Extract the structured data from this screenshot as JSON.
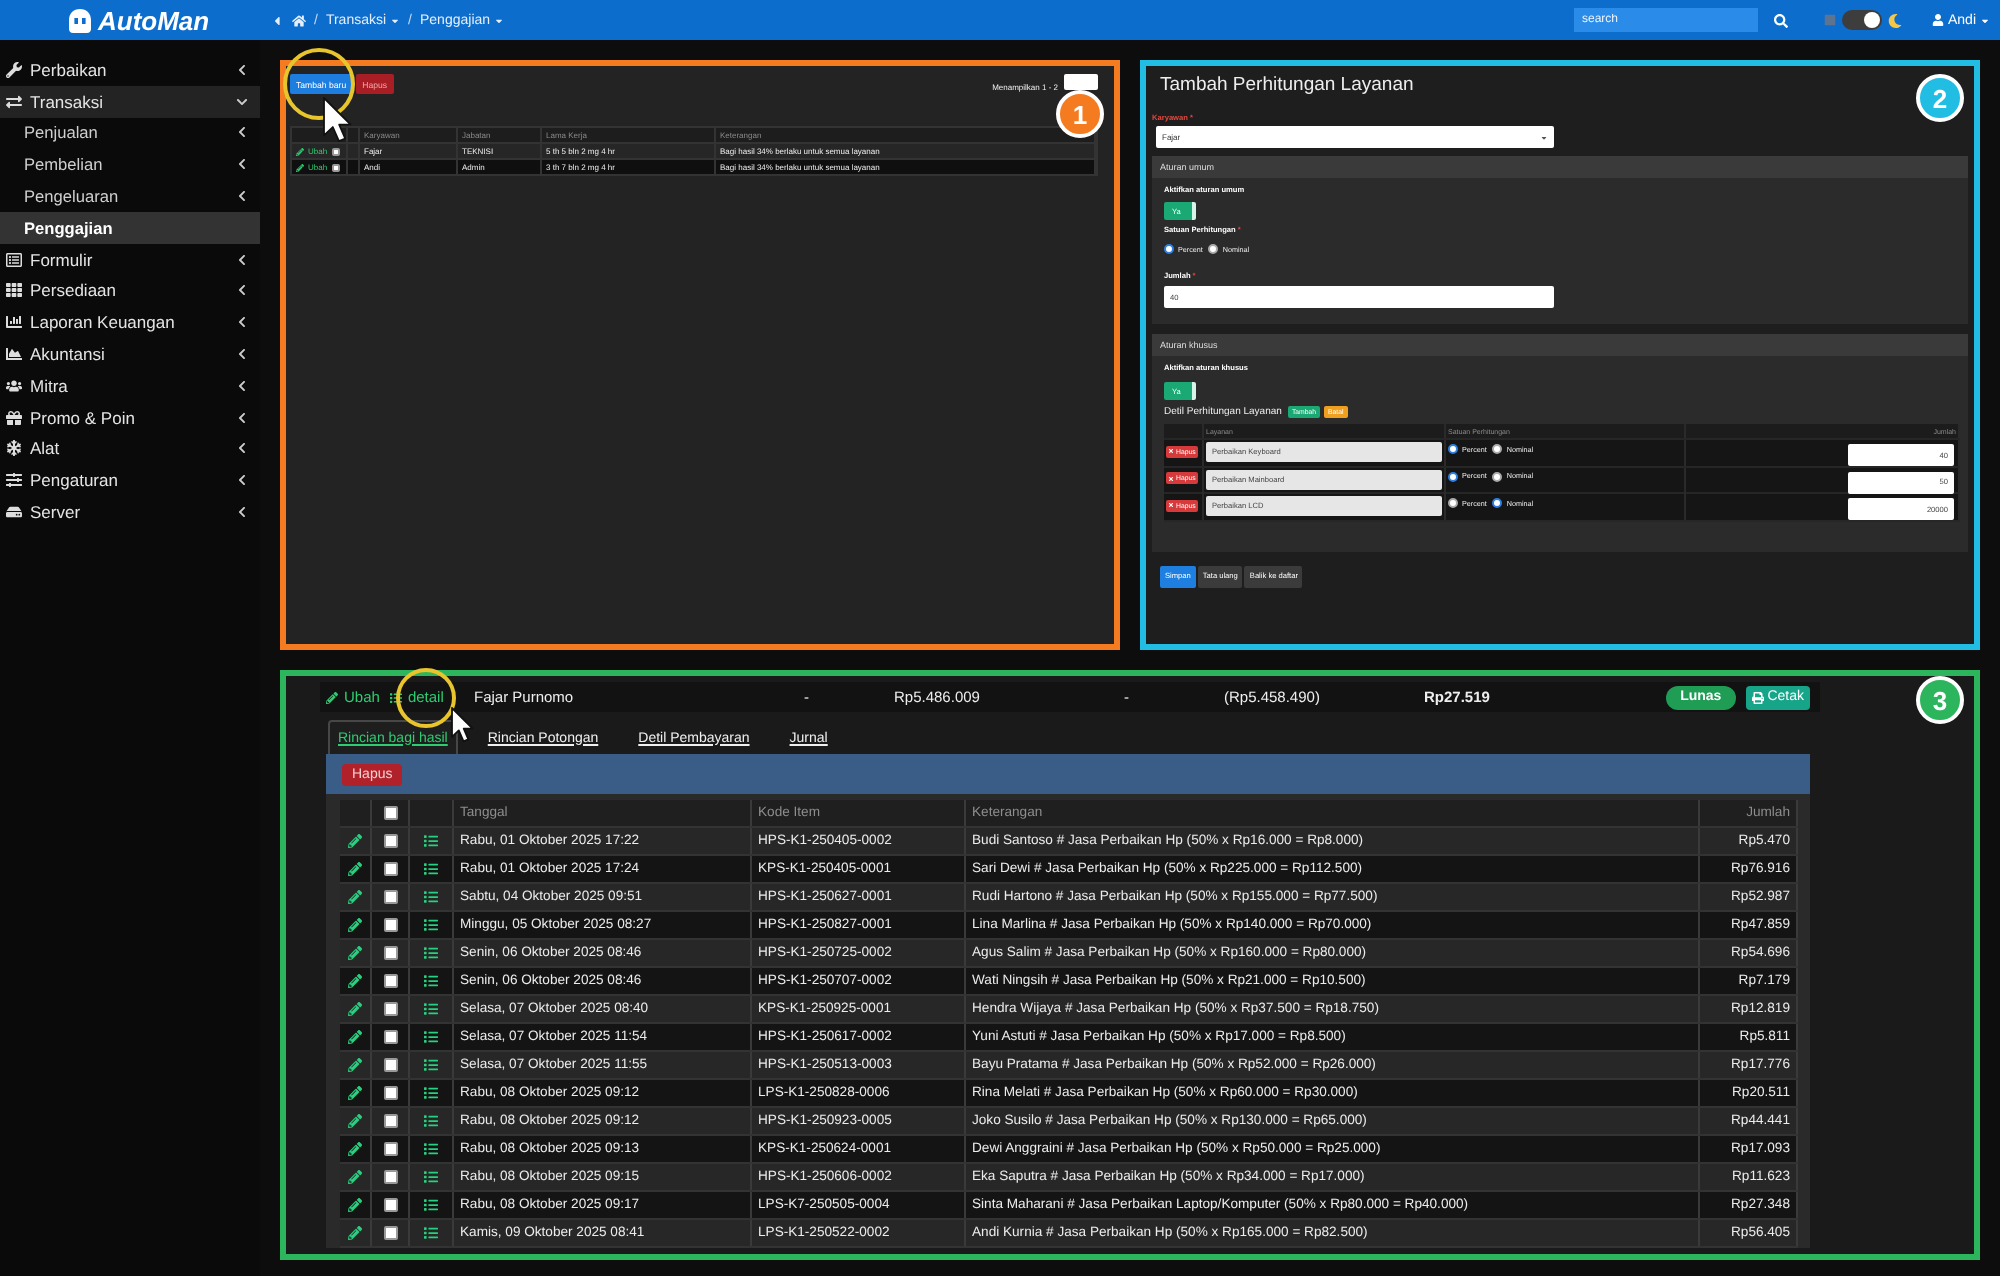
{
  "top_bar": {
    "logo": "AutoMan",
    "breadcrumb": [
      {
        "kind": "home"
      },
      {
        "kind": "link",
        "separator": "/",
        "label": "Transaksi",
        "dropdown": true
      },
      {
        "kind": "link",
        "separator": "/",
        "label": "Penggajian",
        "dropdown": true
      }
    ],
    "search": {
      "placeholder": "search"
    },
    "theme_toggle": {
      "on": true
    },
    "user": {
      "name": "Andi",
      "dropdown": true
    }
  },
  "sidebar": {
    "items": [
      {
        "label": "Perbaikan",
        "expanded": false
      },
      {
        "label": "Transaksi",
        "expanded": true,
        "children": [
          {
            "label": "Penjualan",
            "submenu": true,
            "selected": false
          },
          {
            "label": "Pembelian",
            "submenu": true,
            "selected": false
          },
          {
            "label": "Pengeluaran",
            "submenu": true,
            "selected": false
          },
          {
            "label": "Penggajian",
            "submenu": false,
            "selected": true
          }
        ]
      },
      {
        "label": "Formulir",
        "expanded": false
      },
      {
        "label": "Persediaan",
        "expanded": false
      },
      {
        "label": "Laporan Keuangan",
        "expanded": false
      },
      {
        "label": "Akuntansi",
        "expanded": false
      },
      {
        "label": "Mitra",
        "expanded": false
      },
      {
        "label": "Promo & Poin",
        "expanded": false
      },
      {
        "label": "Alat",
        "expanded": false
      },
      {
        "label": "Pengaturan",
        "expanded": false
      },
      {
        "label": "Server",
        "expanded": false
      }
    ]
  },
  "panels": [
    {
      "kind": "employee_list",
      "badge": "1",
      "color": "#f47b20",
      "buttons": [
        {
          "kind": "primary",
          "label": "Tambah baru"
        },
        {
          "kind": "danger",
          "label": "Hapus"
        }
      ],
      "showing": "Menampilkan 1 - 2",
      "columns": [
        "Karyawan",
        "Jabatan",
        "Lama Kerja",
        "Keterangan"
      ],
      "rows": [
        {
          "edit": "Ubah",
          "checked": false,
          "cells": [
            "Fajar",
            "TEKNISI",
            "5 th 5 bln 2 mg 4 hr",
            "Bagi hasil 34% berlaku untuk semua layanan"
          ]
        },
        {
          "edit": "Ubah",
          "checked": false,
          "cells": [
            "Andi",
            "Admin",
            "3 th 7 bln 2 mg 4 hr",
            "Bagi hasil 34% berlaku untuk semua layanan"
          ]
        }
      ]
    },
    {
      "kind": "service_form",
      "badge": "2",
      "color": "#22bde3",
      "title": "Tambah Perhitungan Layanan",
      "employee": {
        "label": "Karyawan",
        "required_mark": "*",
        "value": "Fajar"
      },
      "general_rule": {
        "heading": "Aturan umum",
        "enable_label": "Aktifkan aturan umum",
        "toggle": {
          "label": "Ya",
          "on": true
        },
        "unit": {
          "label": "Satuan Perhitungan",
          "required_mark": "*",
          "options": [
            {
              "label": "Percent",
              "selected": true
            },
            {
              "label": "Nominal",
              "selected": false
            }
          ]
        },
        "amount": {
          "label": "Jumlah",
          "required_mark": "*",
          "value": "40"
        }
      },
      "special_rule": {
        "heading": "Aturan khusus",
        "enable_label": "Aktifkan aturan khusus",
        "toggle": {
          "label": "Ya",
          "on": true
        },
        "detail_label": "Detil Perhitungan Layanan",
        "add_button": "Tambah",
        "cancel_button": "Batal",
        "columns": [
          "Layanan",
          "Satuan Perhitungan",
          "Jumlah"
        ],
        "rows": [
          {
            "delete_button": "Hapus",
            "service": "Perbaikan Keyboard",
            "options": [
              {
                "label": "Percent",
                "selected": true
              },
              {
                "label": "Nominal",
                "selected": false
              }
            ],
            "amount": "40"
          },
          {
            "delete_button": "Hapus",
            "service": "Perbaikan Mainboard",
            "options": [
              {
                "label": "Percent",
                "selected": true
              },
              {
                "label": "Nominal",
                "selected": false
              }
            ],
            "amount": "50"
          },
          {
            "delete_button": "Hapus",
            "service": "Perbaikan LCD",
            "options": [
              {
                "label": "Percent",
                "selected": false
              },
              {
                "label": "Nominal",
                "selected": true
              }
            ],
            "amount": "20000"
          }
        ]
      },
      "buttons": [
        {
          "kind": "primary",
          "label": "Simpan"
        },
        {
          "kind": "secondary",
          "label": "Tata ulang"
        },
        {
          "kind": "secondary",
          "label": "Balik ke daftar"
        }
      ]
    },
    {
      "kind": "payroll",
      "badge": "3",
      "color": "#2db55d",
      "summary": {
        "edit_link": "Ubah",
        "detail_link": "detail",
        "employee": "Fajar Purnomo",
        "cells": [
          "-",
          "Rp5.486.009",
          "-",
          "(Rp5.458.490)"
        ],
        "total": "Rp27.519",
        "status": "Lunas",
        "print_button": "Cetak"
      },
      "tabs": [
        {
          "label": "Rincian bagi hasil",
          "selected": true
        },
        {
          "label": "Rincian Potongan",
          "selected": false
        },
        {
          "label": "Detil Pembayaran",
          "selected": false
        },
        {
          "label": "Jurnal",
          "selected": false
        }
      ],
      "delete_button": "Hapus",
      "table": {
        "select_all_checked": false,
        "columns": [
          "Tanggal",
          "Kode Item",
          "Keterangan",
          "Jumlah"
        ],
        "rows": [
          {
            "checked": false,
            "date": "Rabu, 01 Oktober 2025 17:22",
            "code": "HPS-K1-250405-0002",
            "description": "Budi Santoso # Jasa Perbaikan Hp (50% x Rp16.000 = Rp8.000)",
            "amount": "Rp5.470"
          },
          {
            "checked": false,
            "date": "Rabu, 01 Oktober 2025 17:24",
            "code": "KPS-K1-250405-0001",
            "description": "Sari Dewi # Jasa Perbaikan Hp (50% x Rp225.000 = Rp112.500)",
            "amount": "Rp76.916"
          },
          {
            "checked": false,
            "date": "Sabtu, 04 Oktober 2025 09:51",
            "code": "HPS-K1-250627-0001",
            "description": "Rudi Hartono # Jasa Perbaikan Hp (50% x Rp155.000 = Rp77.500)",
            "amount": "Rp52.987"
          },
          {
            "checked": false,
            "date": "Minggu, 05 Oktober 2025 08:27",
            "code": "HPS-K1-250827-0001",
            "description": "Lina Marlina # Jasa Perbaikan Hp (50% x Rp140.000 = Rp70.000)",
            "amount": "Rp47.859"
          },
          {
            "checked": false,
            "date": "Senin, 06 Oktober 2025 08:46",
            "code": "HPS-K1-250725-0002",
            "description": "Agus Salim # Jasa Perbaikan Hp (50% x Rp160.000 = Rp80.000)",
            "amount": "Rp54.696"
          },
          {
            "checked": false,
            "date": "Senin, 06 Oktober 2025 08:46",
            "code": "HPS-K1-250707-0002",
            "description": "Wati Ningsih # Jasa Perbaikan Hp (50% x Rp21.000 = Rp10.500)",
            "amount": "Rp7.179"
          },
          {
            "checked": false,
            "date": "Selasa, 07 Oktober 2025 08:40",
            "code": "KPS-K1-250925-0001",
            "description": "Hendra Wijaya # Jasa Perbaikan Hp (50% x Rp37.500 = Rp18.750)",
            "amount": "Rp12.819"
          },
          {
            "checked": false,
            "date": "Selasa, 07 Oktober 2025 11:54",
            "code": "HPS-K1-250617-0002",
            "description": "Yuni Astuti # Jasa Perbaikan Hp (50% x Rp17.000 = Rp8.500)",
            "amount": "Rp5.811"
          },
          {
            "checked": false,
            "date": "Selasa, 07 Oktober 2025 11:55",
            "code": "HPS-K1-250513-0003",
            "description": "Bayu Pratama # Jasa Perbaikan Hp (50% x Rp52.000 = Rp26.000)",
            "amount": "Rp17.776"
          },
          {
            "checked": false,
            "date": "Rabu, 08 Oktober 2025 09:12",
            "code": "LPS-K1-250828-0006",
            "description": "Rina Melati # Jasa Perbaikan Hp (50% x Rp60.000 = Rp30.000)",
            "amount": "Rp20.511"
          },
          {
            "checked": false,
            "date": "Rabu, 08 Oktober 2025 09:12",
            "code": "HPS-K1-250923-0005",
            "description": "Joko Susilo # Jasa Perbaikan Hp (50% x Rp130.000 = Rp65.000)",
            "amount": "Rp44.441"
          },
          {
            "checked": false,
            "date": "Rabu, 08 Oktober 2025 09:13",
            "code": "KPS-K1-250624-0001",
            "description": "Dewi Anggraini # Jasa Perbaikan Hp (50% x Rp50.000 = Rp25.000)",
            "amount": "Rp17.093"
          },
          {
            "checked": false,
            "date": "Rabu, 08 Oktober 2025 09:15",
            "code": "HPS-K1-250606-0002",
            "description": "Eka Saputra # Jasa Perbaikan Hp (50% x Rp34.000 = Rp17.000)",
            "amount": "Rp11.623"
          },
          {
            "checked": false,
            "date": "Rabu, 08 Oktober 2025 09:17",
            "code": "LPS-K7-250505-0004",
            "description": "Sinta Maharani # Jasa Perbaikan Laptop/Komputer (50% x Rp80.000 = Rp40.000)",
            "amount": "Rp27.348"
          },
          {
            "checked": false,
            "date": "Kamis, 09 Oktober 2025 08:41",
            "code": "LPS-K1-250522-0002",
            "description": "Andi Kurnia # Jasa Perbaikan Hp (50% x Rp165.000 = Rp82.500)",
            "amount": "Rp56.405"
          }
        ]
      }
    }
  ]
}
